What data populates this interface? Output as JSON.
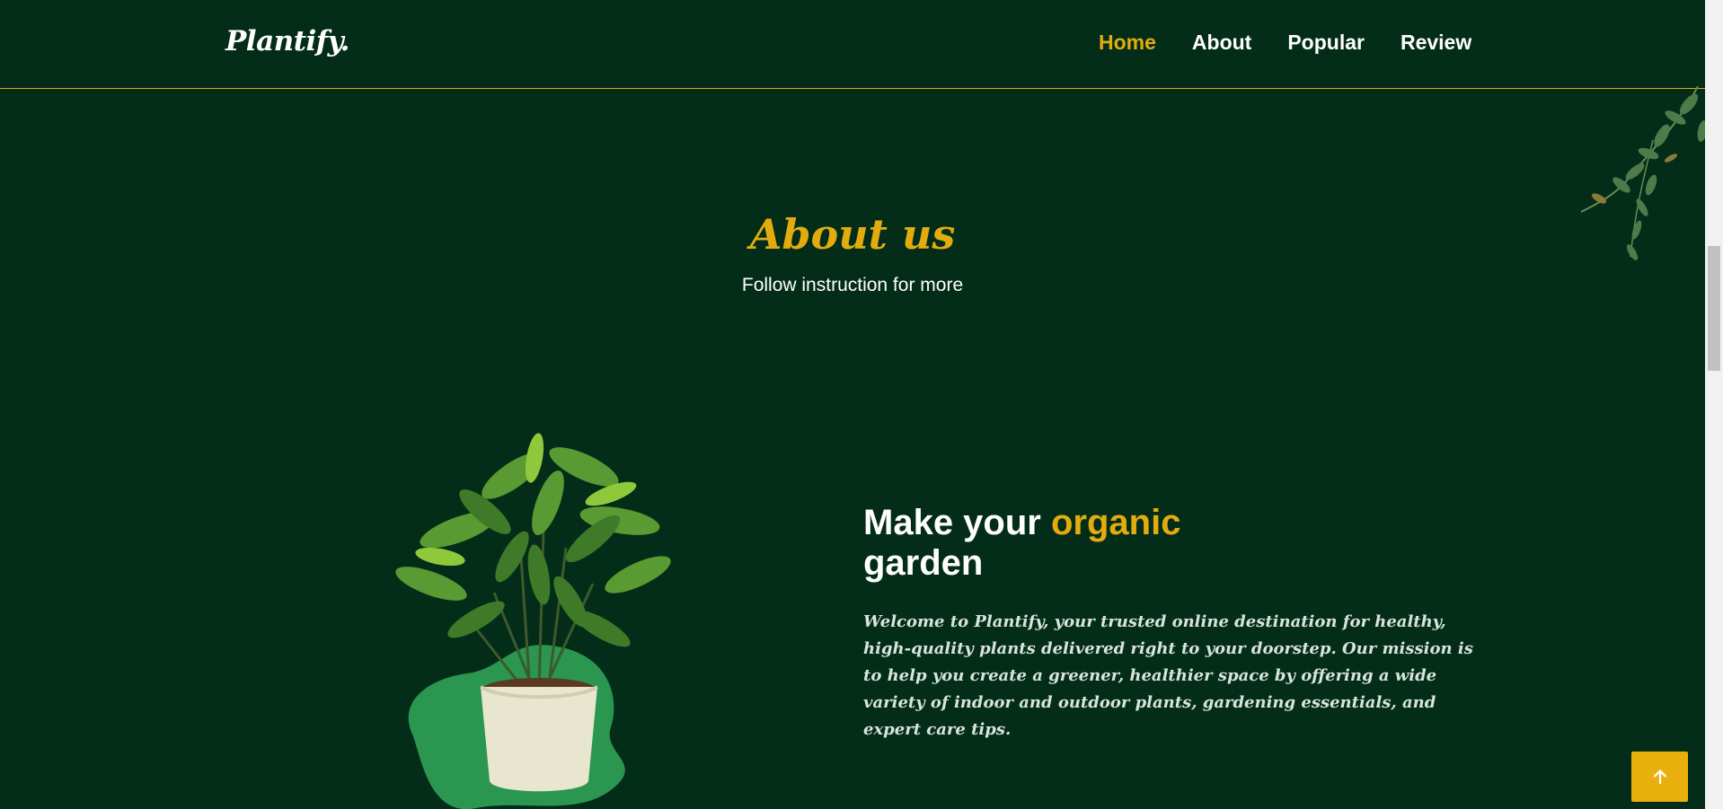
{
  "header": {
    "logo": "Plantify.",
    "nav": [
      {
        "label": "Home",
        "active": true
      },
      {
        "label": "About",
        "active": false
      },
      {
        "label": "Popular",
        "active": false
      },
      {
        "label": "Review",
        "active": false
      }
    ]
  },
  "about": {
    "title": "About us",
    "subtitle": "Follow instruction for more",
    "headline_part1": "Make your ",
    "headline_accent": "organic",
    "headline_part2": "garden",
    "description": "Welcome to Plantify, your trusted online destination for healthy, high-quality plants delivered right to your doorstep. Our mission is to help you create a greener, healthier space by offering a wide variety of indoor and outdoor plants, gardening essentials, and expert care tips."
  },
  "icons": {
    "scroll_top": "arrow-up-icon",
    "decoration": "leaves-icon",
    "plant": "potted-plant-icon"
  },
  "colors": {
    "background": "#032d19",
    "accent": "#e2ac0f",
    "blob": "#2a9650"
  }
}
